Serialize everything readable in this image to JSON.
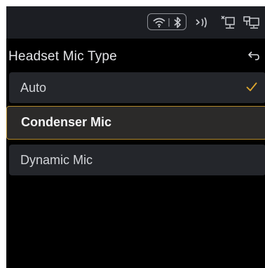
{
  "status_bar": {
    "icons": [
      "wifi-icon",
      "bluetooth-icon",
      "nfc-icon",
      "network-icon",
      "device-icon"
    ]
  },
  "header": {
    "title": "Headset Mic Type",
    "back_icon": "back-arrow-icon"
  },
  "options": [
    {
      "label": "Auto",
      "checked": true,
      "focused": false
    },
    {
      "label": "Condenser Mic",
      "checked": false,
      "focused": true
    },
    {
      "label": "Dynamic Mic",
      "checked": false,
      "focused": false
    }
  ],
  "colors": {
    "screen_background": "#000000",
    "status_bar": "#1c1e23",
    "option_background": "#24262b",
    "focus_border": "#b38a2c",
    "check_color": "#e0a82e",
    "icon_color": "#c9cbd0"
  }
}
